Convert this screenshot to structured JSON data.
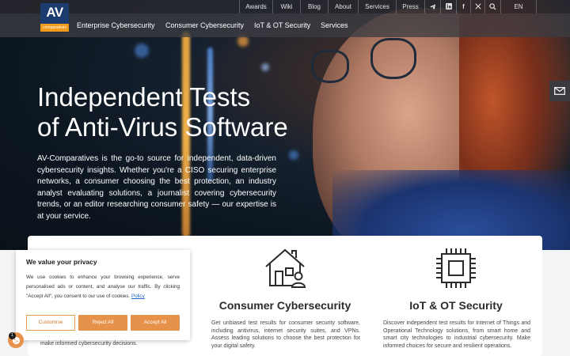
{
  "logo": {
    "main": "AV",
    "sub": "comparatives"
  },
  "topbar": {
    "links": [
      "Awards",
      "Wiki",
      "Blog",
      "About",
      "Services",
      "Press"
    ],
    "language": "EN",
    "icons": [
      "telegram-icon",
      "linkedin-icon",
      "facebook-icon",
      "x-icon",
      "search-icon"
    ]
  },
  "mainnav": {
    "items": [
      "Enterprise Cybersecurity",
      "Consumer Cybersecurity",
      "IoT & OT Security",
      "Services"
    ]
  },
  "hero": {
    "title_line1": "Independent Tests",
    "title_line2": "of Anti-Virus Software",
    "text": "AV-Comparatives is the go-to source for independent, data-driven cybersecurity insights. Whether you're a CISO securing enterprise networks, a consumer choosing the best protection, an industry analyst evaluating solutions, a journalist covering cybersecurity trends, or an editor researching consumer safety — our expertise is at your service."
  },
  "cards": {
    "enterprise": {
      "text_tail": "make informed cybersecurity decisions."
    },
    "consumer": {
      "title": "Consumer Cybersecurity",
      "text": "Get unbiased test results for consumer security software, including antivirus, internet security suites, and VPNs. Assess leading solutions to choose the best protection for your digital safety."
    },
    "iot": {
      "title": "IoT & OT Security",
      "text": "Discover independent test results for Internet of Things and Operational Technology solutions, from smart home and smart city technologies to industrial cybersecurity. Make informed choices for secure and resilient operations."
    }
  },
  "cookie": {
    "title": "We value your privacy",
    "text": "We use cookies to enhance your browsing experience, serve personalised ads or content, and analyse our traffic. By clicking \"Accept All\", you consent to our use of cookies.",
    "policy_link": "Policy",
    "customise": "Customise",
    "reject": "Reject All",
    "accept": "Accept All",
    "badge_count": "1"
  },
  "colors": {
    "accent": "#e7924a",
    "logo_blue": "#1c3b6e",
    "logo_orange": "#f29a1a",
    "link": "#1f63c6"
  }
}
